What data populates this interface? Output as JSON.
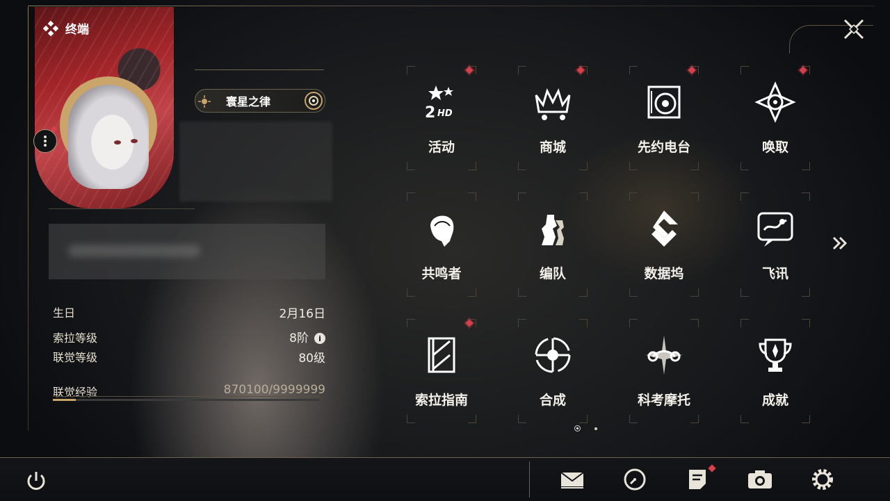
{
  "terminal": {
    "label": "终端"
  },
  "profile": {
    "title_badge": "寰星之律",
    "birthday_label": "生日",
    "birthday_value": "2月16日",
    "sola_level_label": "索拉等级",
    "sola_level_value": "8阶",
    "union_level_label": "联觉等级",
    "union_level_value": "80级",
    "union_exp_label": "联觉经验",
    "union_exp_value": "870100/9999999",
    "union_exp_progress": 0.087
  },
  "menu": {
    "items": [
      {
        "label": "活动",
        "icon": "event-icon",
        "has_dot": true
      },
      {
        "label": "商城",
        "icon": "shop-icon",
        "has_dot": true
      },
      {
        "label": "先约电台",
        "icon": "radio-icon",
        "has_dot": true
      },
      {
        "label": "唤取",
        "icon": "convene-icon",
        "has_dot": true
      },
      {
        "label": "共鸣者",
        "icon": "resonator-icon",
        "has_dot": false
      },
      {
        "label": "编队",
        "icon": "team-icon",
        "has_dot": false
      },
      {
        "label": "数据坞",
        "icon": "data-bank-icon",
        "has_dot": false
      },
      {
        "label": "飞讯",
        "icon": "message-icon",
        "has_dot": false
      },
      {
        "label": "索拉指南",
        "icon": "guidebook-icon",
        "has_dot": true
      },
      {
        "label": "合成",
        "icon": "synthesis-icon",
        "has_dot": false
      },
      {
        "label": "科考摩托",
        "icon": "motorcycle-icon",
        "has_dot": false
      },
      {
        "label": "成就",
        "icon": "trophy-icon",
        "has_dot": false
      }
    ],
    "page_count": 2,
    "current_page": 1
  },
  "bottom_bar": {
    "buttons": [
      "mail-icon",
      "clock-icon",
      "notice-icon",
      "camera-icon",
      "settings-icon"
    ]
  },
  "colors": {
    "accent": "#c9a56c",
    "alert": "#d6404a",
    "text": "#f4f1ea"
  }
}
